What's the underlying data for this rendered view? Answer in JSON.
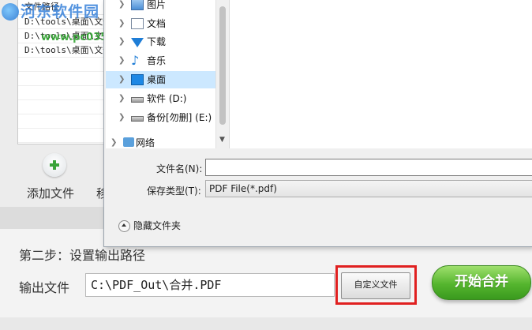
{
  "file_list": {
    "header": "文件路径",
    "rows": [
      "D:\\tools\\桌面\\文件",
      "D:\\tools\\桌面\\文件",
      "D:\\tools\\桌面\\文件"
    ]
  },
  "actions": {
    "add_label": "添加文件",
    "move_label": "移"
  },
  "step2": {
    "title": "第二步：设置输出路径",
    "output_label": "输出文件",
    "output_path": "C:\\PDF_Out\\合并.PDF",
    "custom_button": "自定义文件",
    "start_button": "开始合并"
  },
  "save_dialog": {
    "tree": [
      {
        "label": "图片",
        "icon": "pictures-icon"
      },
      {
        "label": "文档",
        "icon": "documents-icon"
      },
      {
        "label": "下载",
        "icon": "downloads-icon"
      },
      {
        "label": "音乐",
        "icon": "music-icon"
      },
      {
        "label": "桌面",
        "icon": "desktop-icon",
        "selected": true
      },
      {
        "label": "软件 (D:)",
        "icon": "drive-icon"
      },
      {
        "label": "备份[勿删] (E:)",
        "icon": "drive-icon"
      },
      {
        "label": "网络",
        "icon": "network-icon"
      }
    ],
    "filename_label": "文件名(N):",
    "filename_value": "",
    "filetype_label": "保存类型(T):",
    "filetype_value": "PDF File(*.pdf)",
    "hide_folders": "隐藏文件夹"
  },
  "watermark": {
    "text": "河东软件园",
    "url": "www.pc0359.cn"
  },
  "colors": {
    "highlight_box": "#e02020",
    "start_button": "#55b52e",
    "tree_selected": "#cce8ff"
  }
}
